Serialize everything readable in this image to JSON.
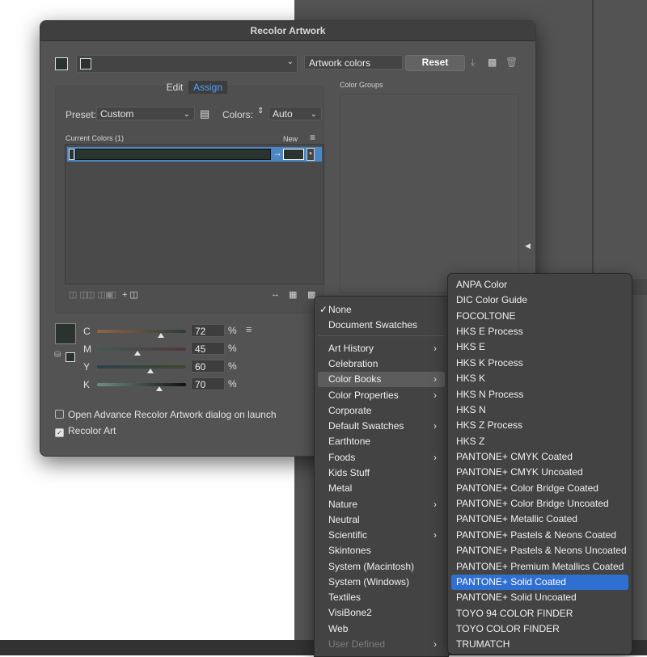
{
  "dialog": {
    "title": "Recolor Artwork",
    "artwork_colors_label": "Artwork colors",
    "reset_label": "Reset",
    "tab_edit": "Edit",
    "tab_assign": "Assign",
    "preset_label": "Preset:",
    "preset_value": "Custom",
    "colors_label": "Colors:",
    "colors_value": "Auto",
    "current_colors_label": "Current Colors (1)",
    "new_label": "New",
    "color_groups_label": "Color Groups",
    "cmyk": [
      {
        "letter": "C",
        "value": "72",
        "unit": "%",
        "fraction": 0.72
      },
      {
        "letter": "M",
        "value": "45",
        "unit": "%",
        "fraction": 0.45
      },
      {
        "letter": "Y",
        "value": "60",
        "unit": "%",
        "fraction": 0.6
      },
      {
        "letter": "K",
        "value": "70",
        "unit": "%",
        "fraction": 0.7
      }
    ],
    "checkbox_open_advance": "Open Advance Recolor Artwork dialog on launch",
    "checkbox_recolor_art": "Recolor Art",
    "checkbox_open_advance_checked": false,
    "checkbox_recolor_art_checked": true,
    "swatch_color": "#2b332e"
  },
  "menu_libraries": {
    "items": [
      {
        "label": "None",
        "checked": true,
        "submenu": false
      },
      {
        "label": "Document Swatches",
        "submenu": false
      },
      {
        "label": "Art History",
        "submenu": true
      },
      {
        "label": "Celebration",
        "submenu": false
      },
      {
        "label": "Color Books",
        "submenu": true,
        "highlighted": true
      },
      {
        "label": "Color Properties",
        "submenu": true
      },
      {
        "label": "Corporate",
        "submenu": false
      },
      {
        "label": "Default Swatches",
        "submenu": true
      },
      {
        "label": "Earthtone",
        "submenu": false
      },
      {
        "label": "Foods",
        "submenu": true
      },
      {
        "label": "Kids Stuff",
        "submenu": false
      },
      {
        "label": "Metal",
        "submenu": false
      },
      {
        "label": "Nature",
        "submenu": true
      },
      {
        "label": "Neutral",
        "submenu": false
      },
      {
        "label": "Scientific",
        "submenu": true
      },
      {
        "label": "Skintones",
        "submenu": false
      },
      {
        "label": "System (Macintosh)",
        "submenu": false
      },
      {
        "label": "System (Windows)",
        "submenu": false
      },
      {
        "label": "Textiles",
        "submenu": false
      },
      {
        "label": "VisiBone2",
        "submenu": false
      },
      {
        "label": "Web",
        "submenu": false
      },
      {
        "label": "User Defined",
        "submenu": true,
        "disabled": true
      }
    ]
  },
  "menu_color_books": {
    "items": [
      {
        "label": "ANPA Color"
      },
      {
        "label": "DIC Color Guide"
      },
      {
        "label": "FOCOLTONE"
      },
      {
        "label": "HKS E Process"
      },
      {
        "label": "HKS E"
      },
      {
        "label": "HKS K Process"
      },
      {
        "label": "HKS K"
      },
      {
        "label": "HKS N Process"
      },
      {
        "label": "HKS N"
      },
      {
        "label": "HKS Z Process"
      },
      {
        "label": "HKS Z"
      },
      {
        "label": "PANTONE+ CMYK Coated"
      },
      {
        "label": "PANTONE+ CMYK Uncoated"
      },
      {
        "label": "PANTONE+ Color Bridge Coated"
      },
      {
        "label": "PANTONE+ Color Bridge Uncoated"
      },
      {
        "label": "PANTONE+ Metallic Coated"
      },
      {
        "label": "PANTONE+ Pastels & Neons Coated"
      },
      {
        "label": "PANTONE+ Pastels & Neons Uncoated"
      },
      {
        "label": "PANTONE+ Premium Metallics Coated"
      },
      {
        "label": "PANTONE+ Solid Coated",
        "selected": true
      },
      {
        "label": "PANTONE+ Solid Uncoated"
      },
      {
        "label": "TOYO 94 COLOR FINDER"
      },
      {
        "label": "TOYO COLOR FINDER"
      },
      {
        "label": "TRUMATCH"
      }
    ]
  },
  "colors": {
    "accent": "#2f6fd1",
    "assign_tab_text": "#4fa0ff"
  }
}
